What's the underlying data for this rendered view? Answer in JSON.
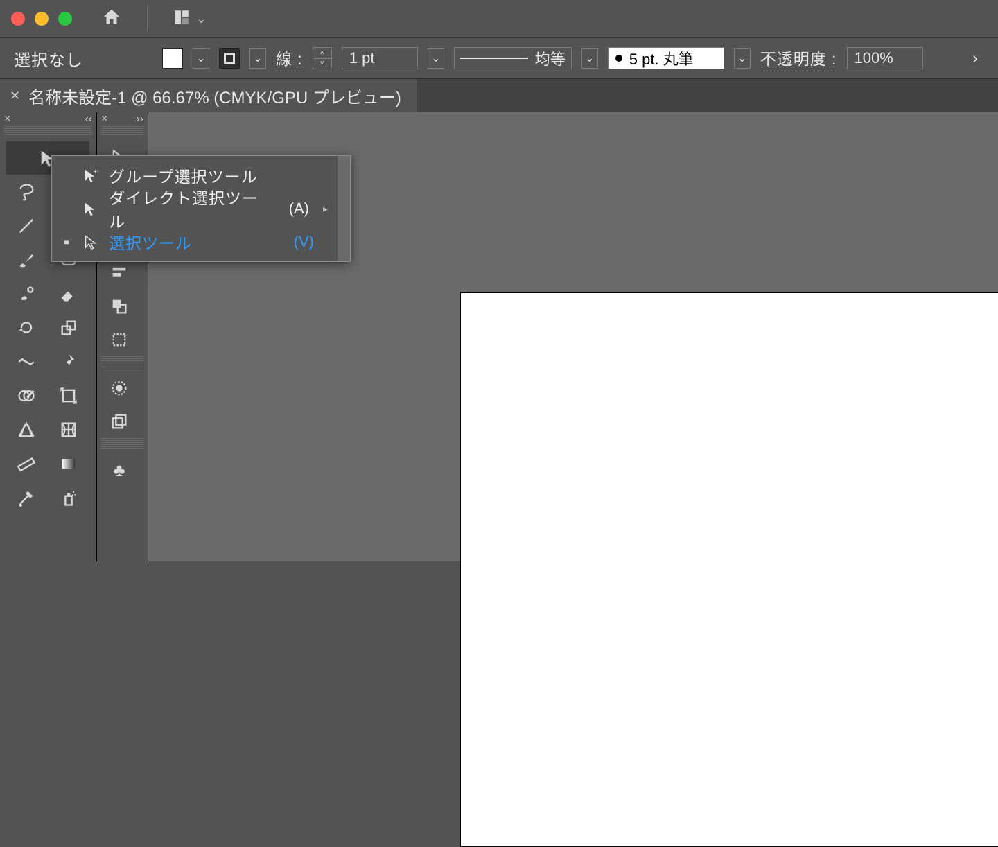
{
  "options": {
    "selection_label": "選択なし",
    "stroke_label": "線 :",
    "stroke_weight": "1 pt",
    "profile_label": "均等",
    "brush_label": "5 pt. 丸筆",
    "opacity_label": "不透明度 :",
    "opacity_value": "100%"
  },
  "doc_tab": {
    "title": "名称未設定-1 @ 66.67% (CMYK/GPU プレビュー)"
  },
  "flyout": {
    "items": [
      {
        "label": "グループ選択ツール",
        "shortcut": "",
        "icon": "group-select",
        "accent": false,
        "checked": false,
        "submenu": false
      },
      {
        "label": "ダイレクト選択ツール",
        "shortcut": "(A)",
        "icon": "direct-select",
        "accent": false,
        "checked": false,
        "submenu": true
      },
      {
        "label": "選択ツール",
        "shortcut": "(V)",
        "icon": "select",
        "accent": true,
        "checked": true,
        "submenu": false
      }
    ]
  },
  "icon_names": {
    "home": "home-icon",
    "workspace": "workspace-switcher-icon"
  }
}
